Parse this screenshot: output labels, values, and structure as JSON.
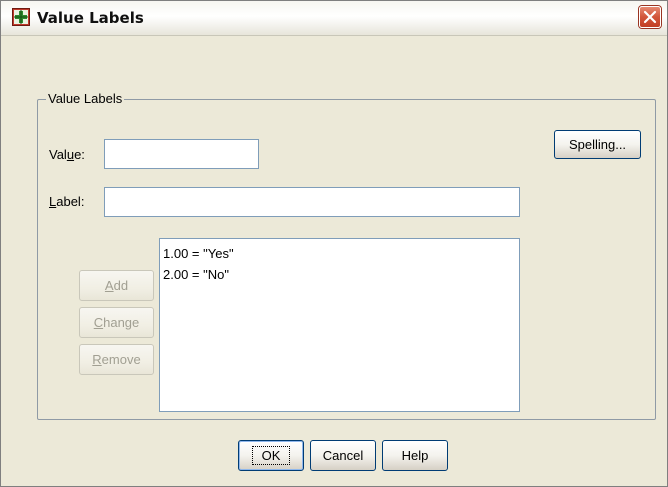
{
  "window": {
    "title": "Value Labels",
    "close_label": "×"
  },
  "group": {
    "label": "Value Labels"
  },
  "value_field": {
    "label_prefix": "Val",
    "label_mnemonic": "u",
    "label_suffix": "e:",
    "value": ""
  },
  "label_field": {
    "label_mnemonic": "L",
    "label_suffix": "abel:",
    "value": ""
  },
  "buttons": {
    "spelling": "Spelling...",
    "add_mnemonic": "A",
    "add_rest": "dd",
    "change_mnemonic": "C",
    "change_rest": "hange",
    "remove_mnemonic": "R",
    "remove_rest": "emove",
    "ok": "OK",
    "cancel": "Cancel",
    "help": "Help"
  },
  "value_label_list": [
    "1.00 = \"Yes\"",
    "2.00 = \"No\""
  ],
  "colors": {
    "dialog_background": "#ECE9D8",
    "button_border": "#003c74",
    "disabled_text": "#a19f92",
    "close_button": "#d2553a",
    "input_border": "#7f9db9"
  },
  "icons": {
    "title": "value-labels-grid-icon",
    "close": "close-x-icon"
  }
}
